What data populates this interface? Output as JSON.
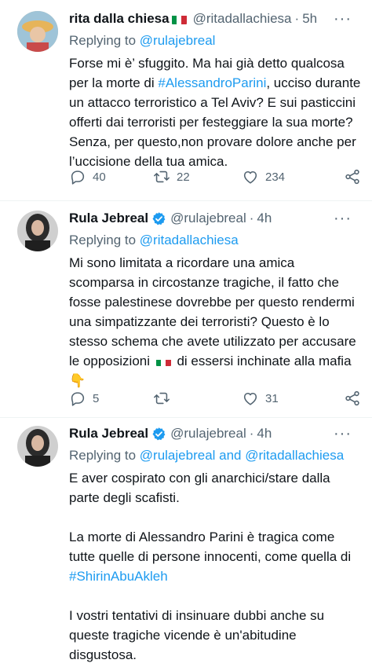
{
  "tweets": [
    {
      "name": "rita dalla chiesa",
      "handle": "@ritadallachiesa",
      "dot": "·",
      "time": "5h",
      "replying_prefix": "Replying to ",
      "replying_to": "@rulajebreal",
      "body_parts": [
        "Forse mi è’ sfuggito. Ma hai già detto qualcosa per la morte di ",
        "#AlessandroParini",
        ", ucciso durante un attacco terroristico a Tel Aviv? E sui pasticcini offerti dai terroristi per festeggiare la sua morte? Senza, per questo,non provare dolore anche per l’uccisione della tua amica."
      ],
      "replies": "40",
      "retweets": "22",
      "likes": "234"
    },
    {
      "name": "Rula Jebreal",
      "handle": "@rulajebreal",
      "dot": "·",
      "time": "4h",
      "replying_prefix": "Replying to ",
      "replying_to": "@ritadallachiesa",
      "body_parts": [
        "Mi sono limitata a ricordare una amica scomparsa in circostanze tragiche, il fatto che fosse palestinese dovrebbe per questo rendermi una simpatizzante dei terroristi? Questo è lo stesso schema che avete utilizzato per accusare le opposizioni ",
        " di essersi inchinate alla mafia",
        "👇"
      ],
      "replies": "5",
      "retweets": "",
      "likes": "31"
    },
    {
      "name": "Rula Jebreal",
      "handle": "@rulajebreal",
      "dot": "·",
      "time": "4h",
      "replying_prefix": "Replying to ",
      "replying_to": "@rulajebreal and @ritadallachiesa",
      "body_parts": [
        "E aver cospirato con gli anarchici/stare dalla parte degli scafisti.\n\nLa morte di Alessandro Parini è tragica come tutte quelle di persone innocenti, come quella di\n",
        "#ShirinAbuAkleh",
        "\n\nI vostri tentativi di insinuare dubbi anche su queste tragiche vicende è un'abitudine disgustosa."
      ]
    }
  ],
  "more_icon_text": "···",
  "colors": {
    "accent": "#1d9bf0",
    "muted": "#536471",
    "text": "#0f1419",
    "verified": "#1d9bf0"
  },
  "icons": [
    "reply-icon",
    "retweet-icon",
    "like-icon",
    "share-icon",
    "verified-icon",
    "italy-flag-icon",
    "more-icon"
  ]
}
